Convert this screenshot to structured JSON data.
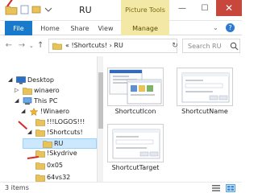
{
  "window": {
    "title": "RU",
    "contextual_title": "Picture Tools"
  },
  "window_controls": {
    "minimize": "—",
    "maximize": "☐",
    "close": "✕"
  },
  "tabs": [
    {
      "label": "File"
    },
    {
      "label": "Home"
    },
    {
      "label": "Share"
    },
    {
      "label": "View"
    },
    {
      "label": "Manage"
    }
  ],
  "help": "?",
  "address": {
    "path": "« !Shortcuts!  ›  RU",
    "refresh": "↻"
  },
  "search": {
    "placeholder": "Search RU"
  },
  "tree": [
    {
      "label": "Desktop",
      "chev": "◢",
      "icon": "desktop"
    },
    {
      "label": "winaero",
      "chev": "▷",
      "icon": "folder"
    },
    {
      "label": "This PC",
      "chev": "◢",
      "icon": "pc"
    },
    {
      "label": "!Winaero",
      "chev": "◢",
      "icon": "star"
    },
    {
      "label": "!!!LOGOS!!!",
      "chev": "",
      "icon": "folder"
    },
    {
      "label": "!Shortcuts!",
      "chev": "◢",
      "icon": "folder"
    },
    {
      "label": "RU",
      "chev": "",
      "icon": "folder",
      "selected": true
    },
    {
      "label": "!Skydrive",
      "chev": "",
      "icon": "folder"
    },
    {
      "label": "0x05",
      "chev": "",
      "icon": "folder"
    },
    {
      "label": "64vs32",
      "chev": "",
      "icon": "folder"
    }
  ],
  "items": [
    {
      "name": "ShortcutIcon"
    },
    {
      "name": "ShortcutName"
    },
    {
      "name": "ShortcutTarget"
    }
  ],
  "status": {
    "count": "3 items"
  },
  "colors": {
    "accent": "#1979ca",
    "contextual": "#f3e8a5",
    "selection": "#cce8ff",
    "annotation": "#d62828",
    "folder": "#e8c35a"
  }
}
